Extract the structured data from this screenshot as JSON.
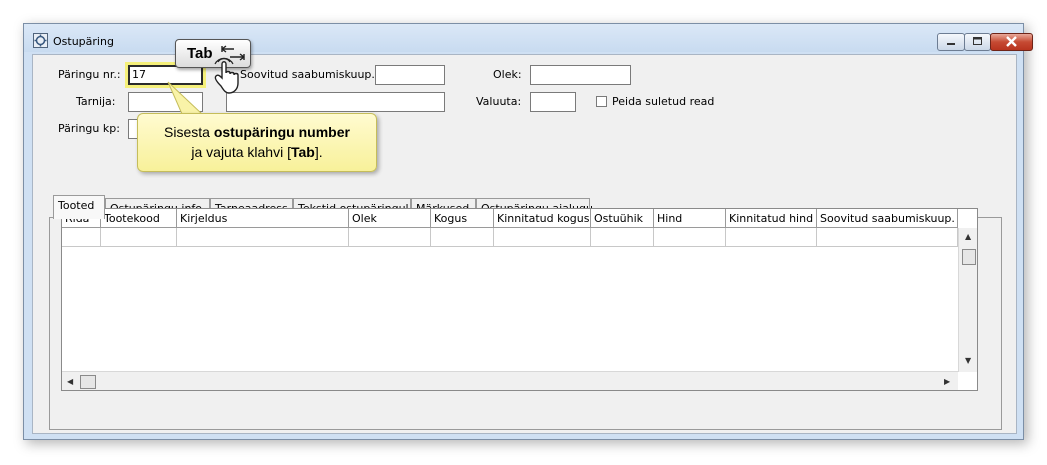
{
  "window": {
    "title": "Ostupäring"
  },
  "form": {
    "request_no_label": "Päringu nr.:",
    "request_no_value": "17",
    "desired_arrival_label": "Soovitud saabumiskuup.:",
    "desired_arrival_value": "",
    "status_label": "Olek:",
    "status_value": "",
    "supplier_label": "Tarnija:",
    "supplier_value": "",
    "currency_label": "Valuuta:",
    "currency_value": "",
    "hide_closed_label": "Peida suletud read",
    "request_date_label": "Päringu kp:",
    "request_date_value": ""
  },
  "tabs": [
    "Tooted",
    "Ostupäringu info",
    "Tarneaadress",
    "Tekstid ostupäringul",
    "Märkused",
    "Ostupäringu ajalugu"
  ],
  "grid": {
    "columns": [
      "Rida",
      "Tootekood",
      "Kirjeldus",
      "Olek",
      "Kogus",
      "Kinnitatud kogus",
      "Ostuühik",
      "Hind",
      "Kinnitatud hind",
      "Soovitud saabumiskuup."
    ]
  },
  "tutorial": {
    "key_label": "Tab",
    "callout_prefix": "Sisesta ",
    "callout_bold": "ostupäringu number",
    "callout_line2_prefix": "ja vajuta klahvi [",
    "callout_line2_key": "Tab",
    "callout_line2_suffix": "]."
  }
}
